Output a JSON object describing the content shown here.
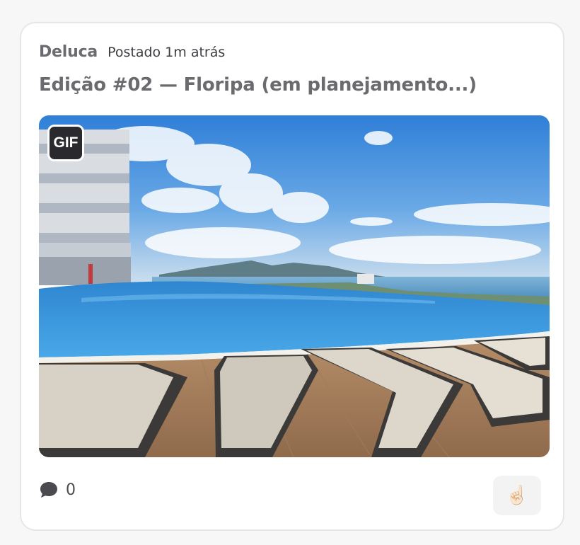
{
  "post": {
    "author": "Deluca",
    "timestamp": "Postado 1m atrás",
    "title": "Edição #02 — Floripa (em planejamento...)",
    "media": {
      "badge": "GIF",
      "alt": "Infinity pool with sun loungers overlooking the sea and hills"
    },
    "comments": {
      "icon": "speech-bubble-icon",
      "count": "0"
    },
    "reaction": {
      "icon": "pointing-hand-icon",
      "glyph": "☝🏻"
    }
  },
  "colors": {
    "card_border": "#e6e6e9",
    "muted_text": "#6b6b6f",
    "sky": "#3f8fe0",
    "pool": "#2f8fd6"
  }
}
